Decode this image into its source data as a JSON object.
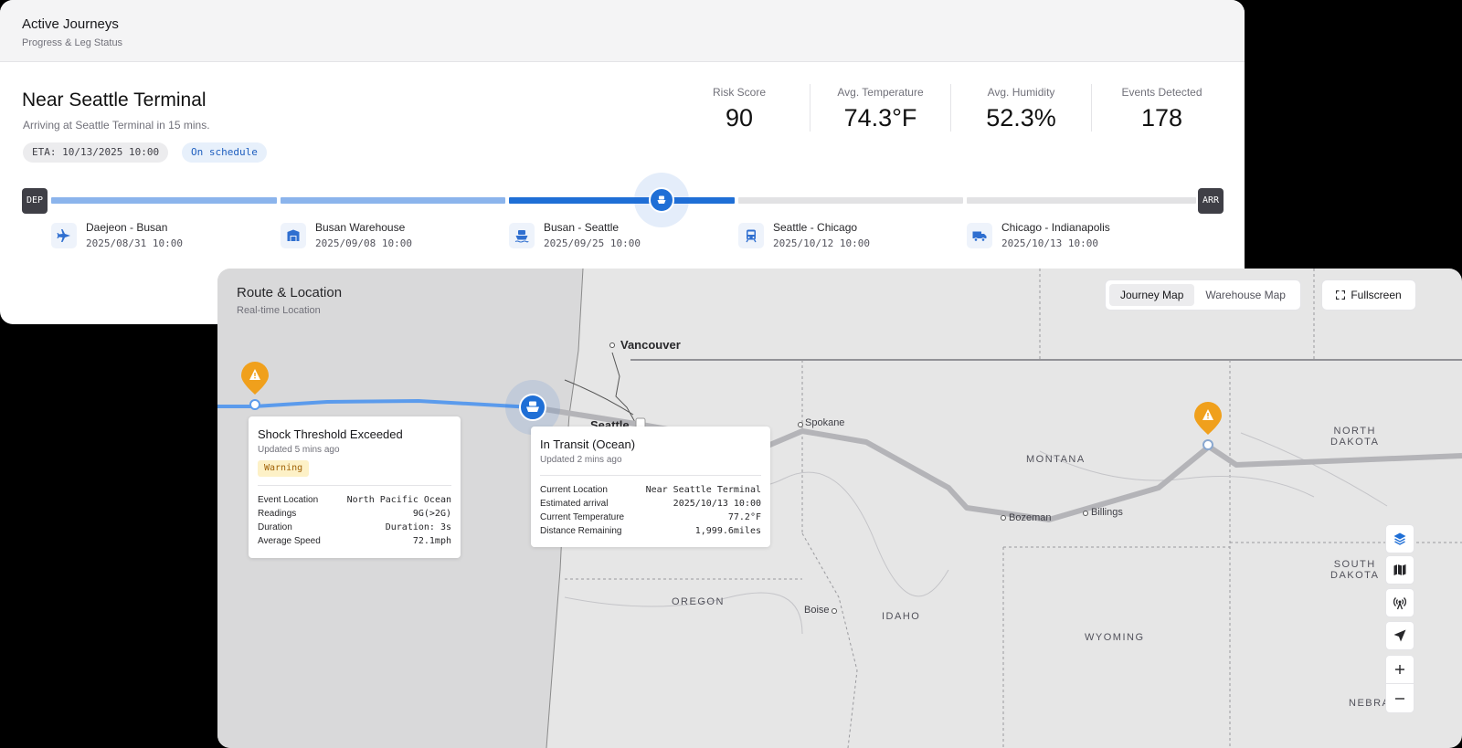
{
  "journey": {
    "header": {
      "title": "Active Journeys",
      "subtitle": "Progress & Leg Status"
    },
    "location_title": "Near Seattle Terminal",
    "location_subtitle": "Arriving at Seattle Terminal in 15 mins.",
    "eta": "ETA: 10/13/2025 10:00",
    "schedule_status": "On schedule",
    "metrics": [
      {
        "label": "Risk Score",
        "value": "90"
      },
      {
        "label": "Avg. Temperature",
        "value": "74.3°F"
      },
      {
        "label": "Avg. Humidity",
        "value": "52.3%"
      },
      {
        "label": "Events Detected",
        "value": "178"
      }
    ],
    "dep_label": "DEP",
    "arr_label": "ARR",
    "current_leg_progress": 0.67,
    "legs": [
      {
        "name": "Daejeon - Busan",
        "date": "2025/08/31 10:00",
        "icon": "airplane-icon",
        "status": "done"
      },
      {
        "name": "Busan Warehouse",
        "date": "2025/09/08 10:00",
        "icon": "warehouse-icon",
        "status": "done"
      },
      {
        "name": "Busan - Seattle",
        "date": "2025/09/25 10:00",
        "icon": "ship-icon",
        "status": "active"
      },
      {
        "name": "Seattle - Chicago",
        "date": "2025/10/12 10:00",
        "icon": "train-icon",
        "status": "pending"
      },
      {
        "name": "Chicago - Indianapolis",
        "date": "2025/10/13 10:00",
        "icon": "truck-icon",
        "status": "pending"
      }
    ],
    "colors": {
      "done": "#8bb4ec",
      "active": "#1f6fd6",
      "pending": "#e2e2e4"
    }
  },
  "map": {
    "title": "Route & Location",
    "subtitle": "Real-time Location",
    "view_toggle": {
      "options": [
        "Journey Map",
        "Warehouse Map"
      ],
      "selected": "Journey Map"
    },
    "fullscreen_label": "Fullscreen",
    "places": {
      "vancouver": "Vancouver",
      "seattle": "Seattle",
      "spokane": "Spokane",
      "bozeman": "Bozeman",
      "billings": "Billings",
      "boise": "Boise"
    },
    "states": {
      "montana": "MONTANA",
      "oregon": "OREGON",
      "idaho": "IDAHO",
      "wyoming": "WYOMING",
      "north_dakota_1": "NORTH",
      "north_dakota_2": "DAKOTA",
      "south_dakota_1": "SOUTH",
      "south_dakota_2": "DAKOTA",
      "nebraska": "NEBRA"
    },
    "shock_popup": {
      "title": "Shock Threshold Exceeded",
      "updated": "Updated 5 mins ago",
      "severity": "Warning",
      "rows": [
        {
          "label": "Event Location",
          "value": "North Pacific Ocean"
        },
        {
          "label": "Readings",
          "value": "9G(>2G)"
        },
        {
          "label": "Duration",
          "value": "Duration: 3s"
        },
        {
          "label": "Average Speed",
          "value": "72.1mph"
        }
      ]
    },
    "transit_popup": {
      "title": "In Transit (Ocean)",
      "updated": "Updated 2 mins ago",
      "rows": [
        {
          "label": "Current Location",
          "value": "Near Seattle Terminal"
        },
        {
          "label": "Estimated arrival",
          "value": "2025/10/13 10:00"
        },
        {
          "label": "Current Temperature",
          "value": "77.2°F"
        },
        {
          "label": "Distance Remaining",
          "value": "1,999.6miles"
        }
      ]
    },
    "controls": [
      "layers-icon",
      "map-icon",
      "antenna-icon",
      "navigate-icon",
      "zoom-in-icon",
      "zoom-out-icon"
    ],
    "colors": {
      "route_done": "#5b9bec",
      "route_pending": "#b4b4b8",
      "warning": "#f0a01c",
      "vehicle": "#1f6fd6"
    }
  }
}
